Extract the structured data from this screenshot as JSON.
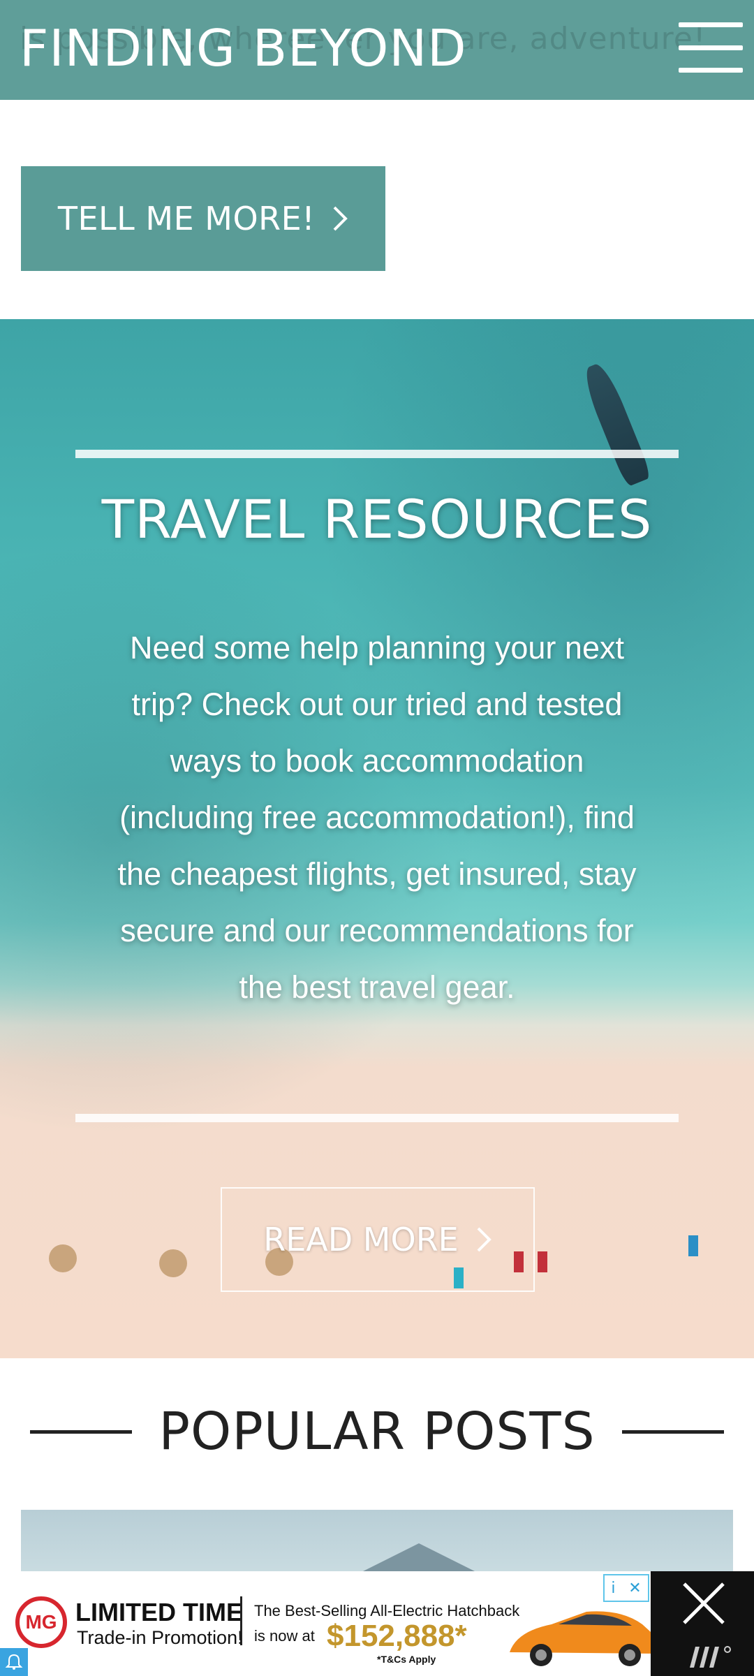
{
  "header": {
    "logo": "FINDING BEYOND",
    "ghost_text": "is possible, whereever you are, adventure!"
  },
  "intro": {
    "cta_label": "TELL ME MORE!"
  },
  "hero": {
    "title": "TRAVEL RESOURCES",
    "body": "Need some help planning your next trip? Check out our tried and tested ways to book accommodation (including free accommodation!), find the cheapest flights, get insured, stay secure and our recommendations for the best travel gear.",
    "cta_label": "READ MORE"
  },
  "popular": {
    "heading": "POPULAR POSTS"
  },
  "ad": {
    "brand": "MG",
    "headline": "LIMITED TIME",
    "subhead": "Trade-in Promotion!",
    "desc_line1": "The Best-Selling All-Electric Hatchback",
    "desc_line2": "is now at",
    "price": "$152,888*",
    "terms": "*T&Cs Apply",
    "adchoices": "i",
    "car_color": "#f08a1c"
  },
  "colors": {
    "header_bg": "#5f9e99",
    "button_bg": "#5a9c97"
  }
}
